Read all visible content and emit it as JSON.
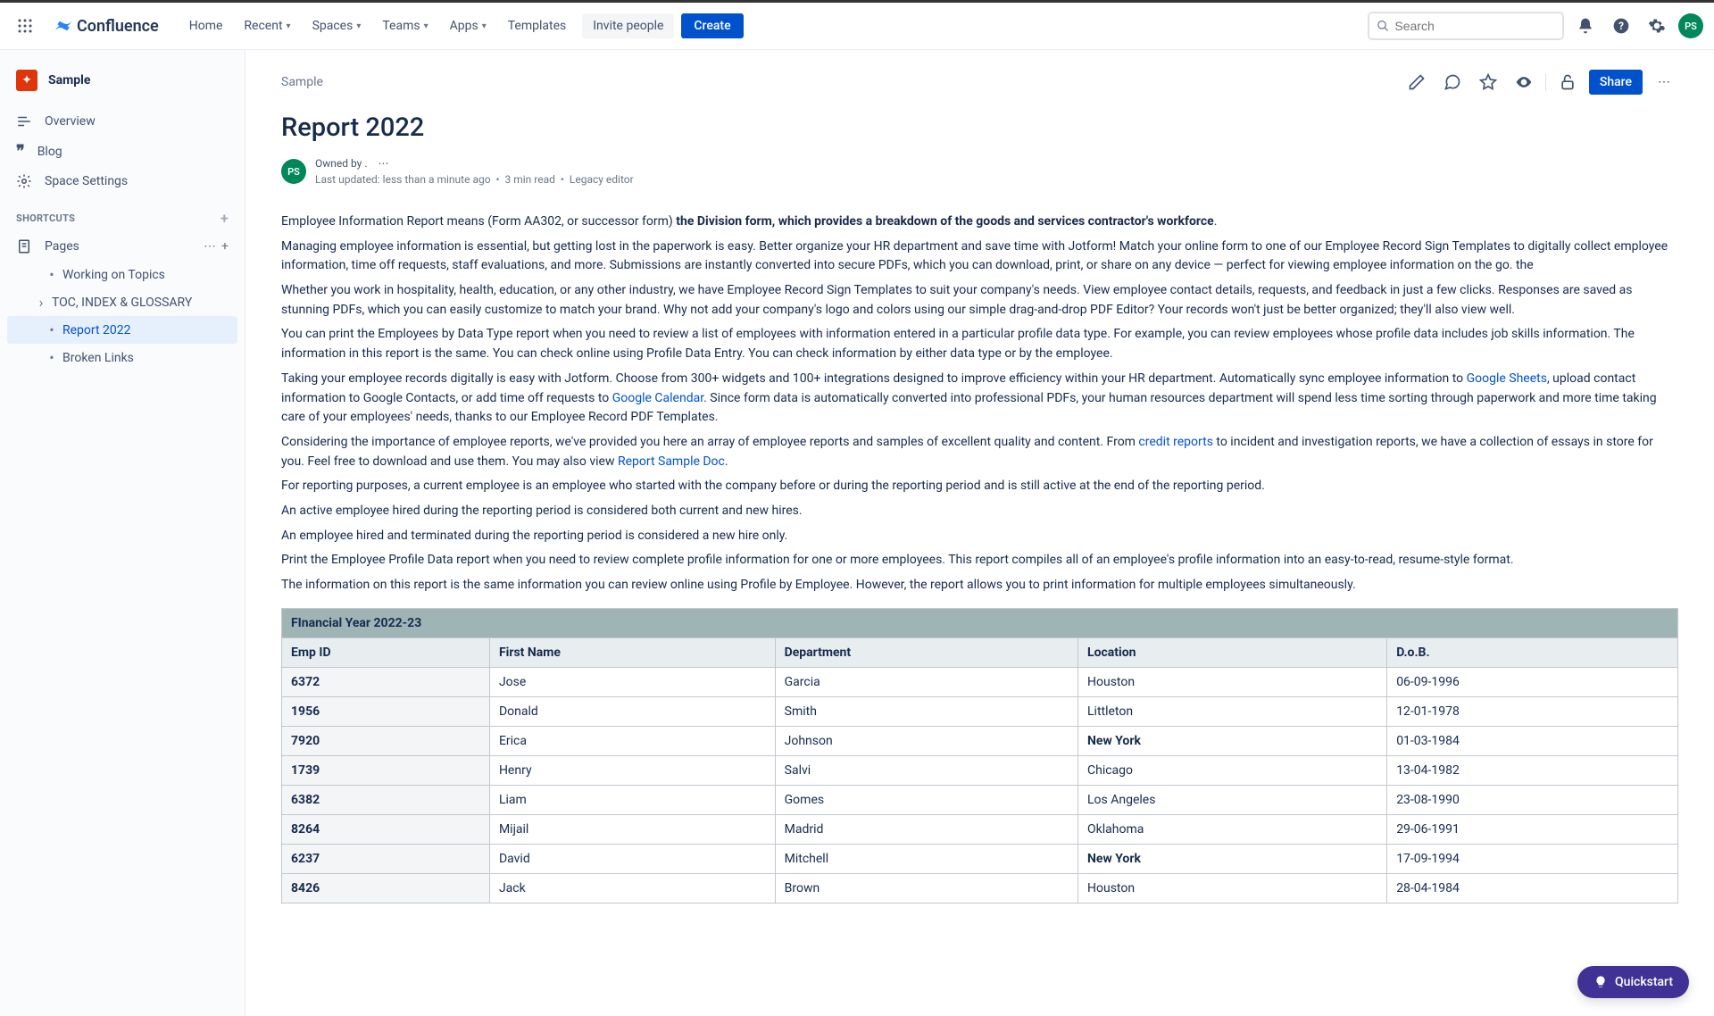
{
  "app": {
    "name": "Confluence"
  },
  "nav": {
    "home": "Home",
    "recent": "Recent",
    "spaces": "Spaces",
    "teams": "Teams",
    "apps": "Apps",
    "templates": "Templates",
    "invite": "Invite people",
    "create": "Create"
  },
  "search": {
    "placeholder": "Search"
  },
  "user": {
    "initials": "PS"
  },
  "sidebar": {
    "space_name": "Sample",
    "overview": "Overview",
    "blog": "Blog",
    "space_settings": "Space Settings",
    "shortcuts_heading": "SHORTCUTS",
    "pages_heading": "Pages",
    "tree": {
      "working": "Working on Topics",
      "toc": "TOC, INDEX & GLOSSARY",
      "report": "Report 2022",
      "broken": "Broken Links"
    }
  },
  "page": {
    "breadcrumb": "Sample",
    "title": "Report 2022",
    "owned_by_prefix": "Owned by",
    "owned_by_suffix": ".",
    "last_updated": "Last updated: less than a minute ago",
    "read_time": "3 min read",
    "legacy": "Legacy editor",
    "share": "Share",
    "avatar_initials": "PS"
  },
  "body": {
    "p1a": "Employee Information Report means (Form AA302, or successor form)  ",
    "p1b": "the Division form, which provides a breakdown of the goods and services contractor's workforce",
    "p1c": ".",
    "p2": "Managing employee information is essential, but getting lost in the paperwork is easy. Better organize your HR department and save time with Jotform! Match your online form to one of our Employee Record Sign Templates to digitally collect employee information, time off requests, staff evaluations, and more. Submissions are instantly converted into secure PDFs, which you can download, print, or share on any device — perfect for viewing employee information on the go.  the",
    "p3": "Whether you work in hospitality, health, education, or any other industry, we have Employee Record Sign Templates to suit your company's needs. View employee contact details, requests, and feedback in just a few clicks. Responses are saved as stunning PDFs, which you can easily customize to match your brand. Why not add your company's logo and colors using our simple drag-and-drop PDF Editor? Your records won't just be better organized; they'll also view well.",
    "p4": "You can print the Employees by Data Type report when you need to review a list of employees with information entered in a particular profile data type. For example, you can review employees whose profile data includes job skills information. The information in this report is the same. You can check online using Profile Data Entry. You can check information by either data type or by the employee.",
    "p5a": "Taking your employee records digitally is easy with Jotform. Choose from 300+ widgets and 100+ integrations designed to improve efficiency within your HR department. Automatically sync employee information to ",
    "p5_link1": "Google Sheets",
    "p5b": ", upload contact information to Google Contacts, or add time off requests to ",
    "p5_link2": "Google Calendar",
    "p5c": ". Since form data is automatically converted into professional PDFs, your human resources department will spend less time sorting through paperwork and more time taking care of your employees' needs, thanks to our Employee Record PDF Templates.",
    "p6a": "Considering the importance of employee reports, we've provided you here an array of employee reports and samples of excellent quality and content. From ",
    "p6_link1": "credit reports",
    "p6b": " to incident and investigation reports, we have a collection of essays in store for you. Feel free to download and use them. You may also view ",
    "p6_link2": "Report Sample Doc",
    "p6c": ".",
    "p7": "For reporting purposes, a current employee is an employee who started with the company before or during the reporting period and is still active at the end of the reporting period.",
    "p8": "An active employee hired during the reporting period is considered both current and new hires.",
    "p9": "An employee hired and terminated during the reporting period is considered a new hire only.",
    "p10": "Print the Employee Profile Data report when you need to review complete profile information for one or more employees. This report compiles all of an employee's profile information into an easy-to-read, resume-style format.",
    "p11": "The information on this report is the same information you can review online using Profile by Employee. However, the report allows you to print information for multiple employees simultaneously."
  },
  "table": {
    "title": "FInancial Year 2022-23",
    "headers": {
      "id": "Emp ID",
      "fname": "First Name",
      "dept": "Department",
      "loc": "Location",
      "dob": "D.o.B."
    },
    "rows": [
      {
        "id": "6372",
        "fname": "Jose",
        "dept": "Garcia",
        "loc": "Houston",
        "loc_bold": false,
        "dob": "06-09-1996"
      },
      {
        "id": "1956",
        "fname": "Donald",
        "dept": "Smith",
        "loc": "Littleton",
        "loc_bold": false,
        "dob": "12-01-1978"
      },
      {
        "id": "7920",
        "fname": "Erica",
        "dept": "Johnson",
        "loc": "New York",
        "loc_bold": true,
        "dob": "01-03-1984"
      },
      {
        "id": "1739",
        "fname": "Henry",
        "dept": "Salvi",
        "loc": "Chicago",
        "loc_bold": false,
        "dob": "13-04-1982"
      },
      {
        "id": "6382",
        "fname": "Liam",
        "dept": "Gomes",
        "loc": "Los Angeles",
        "loc_bold": false,
        "dob": "23-08-1990"
      },
      {
        "id": "8264",
        "fname": "Mijail",
        "dept": "Madrid",
        "loc": "Oklahoma",
        "loc_bold": false,
        "dob": "29-06-1991"
      },
      {
        "id": "6237",
        "fname": "David",
        "dept": "Mitchell",
        "loc": "New York",
        "loc_bold": true,
        "dob": "17-09-1994"
      },
      {
        "id": "8426",
        "fname": "Jack",
        "dept": "Brown",
        "loc": "Houston",
        "loc_bold": false,
        "dob": "28-04-1984"
      }
    ]
  },
  "quickstart": "Quickstart"
}
